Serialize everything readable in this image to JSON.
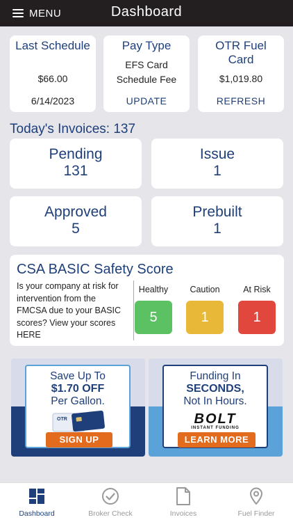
{
  "header": {
    "menu_label": "MENU",
    "title": "Dashboard"
  },
  "top_cards": [
    {
      "title": "Last Schedule",
      "lines": [
        "$66.00",
        "6/14/2023"
      ],
      "action": ""
    },
    {
      "title": "Pay Type",
      "lines": [
        "EFS Card",
        "Schedule Fee"
      ],
      "action": "UPDATE"
    },
    {
      "title": "OTR Fuel Card",
      "lines": [
        "$1,019.80"
      ],
      "action": "REFRESH"
    }
  ],
  "invoices": {
    "title": "Today's Invoices: 137",
    "stats": [
      {
        "label": "Pending",
        "count": "131"
      },
      {
        "label": "Issue",
        "count": "1"
      },
      {
        "label": "Approved",
        "count": "5"
      },
      {
        "label": "Prebuilt",
        "count": "1"
      }
    ]
  },
  "csa": {
    "title": "CSA BASIC Safety Score",
    "description": "Is your company at risk for intervention from the FMCSA due to your BASIC scores? View your scores HERE",
    "scores": [
      {
        "label": "Healthy",
        "value": "5",
        "color": "#5cc163"
      },
      {
        "label": "Caution",
        "value": "1",
        "color": "#e8b838"
      },
      {
        "label": "At Risk",
        "value": "1",
        "color": "#e2473d"
      }
    ]
  },
  "promos": [
    {
      "line1": "Save Up To",
      "line2": "$1.70 OFF",
      "line3": "Per Gallon.",
      "cta": "SIGN UP",
      "card_text": "OTR",
      "accent": "#1f3f7a"
    },
    {
      "line1": "Funding In",
      "line2": "SECONDS,",
      "line3": "Not In Hours.",
      "logo": "BOLT",
      "logo_sub": "INSTANT FUNDING",
      "cta": "LEARN MORE",
      "accent": "#5aa2d8"
    }
  ],
  "tabs": [
    {
      "label": "Dashboard",
      "icon": "dashboard-icon",
      "active": true
    },
    {
      "label": "Broker Check",
      "icon": "check-circle-icon",
      "active": false
    },
    {
      "label": "Invoices",
      "icon": "document-icon",
      "active": false
    },
    {
      "label": "Fuel Finder",
      "icon": "map-pin-icon",
      "active": false
    }
  ],
  "colors": {
    "brand_navy": "#1f3f7a",
    "header_bg": "#231f20",
    "cta_orange": "#e36b1e",
    "page_bg": "#e5e5ea"
  }
}
